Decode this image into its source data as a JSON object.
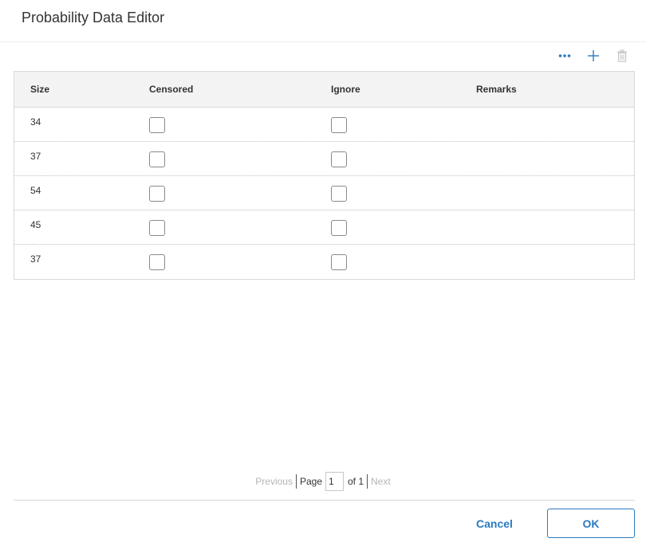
{
  "dialog": {
    "title": "Probability Data Editor"
  },
  "toolbar": {
    "more_icon": "more-horizontal-icon",
    "add_icon": "plus-icon",
    "delete_icon": "trash-icon",
    "accent_color": "#2a7bc0",
    "disabled_color": "#c4c4c4"
  },
  "grid": {
    "columns": [
      "Size",
      "Censored",
      "Ignore",
      "Remarks"
    ],
    "rows": [
      {
        "size": "34",
        "censored": false,
        "ignore": false,
        "remarks": ""
      },
      {
        "size": "37",
        "censored": false,
        "ignore": false,
        "remarks": ""
      },
      {
        "size": "54",
        "censored": false,
        "ignore": false,
        "remarks": ""
      },
      {
        "size": "45",
        "censored": false,
        "ignore": false,
        "remarks": ""
      },
      {
        "size": "37",
        "censored": false,
        "ignore": false,
        "remarks": ""
      }
    ]
  },
  "pager": {
    "previous": "Previous",
    "page_label": "Page",
    "page_value": "1",
    "of_label": "of 1",
    "next": "Next"
  },
  "footer": {
    "cancel": "Cancel",
    "ok": "OK"
  }
}
